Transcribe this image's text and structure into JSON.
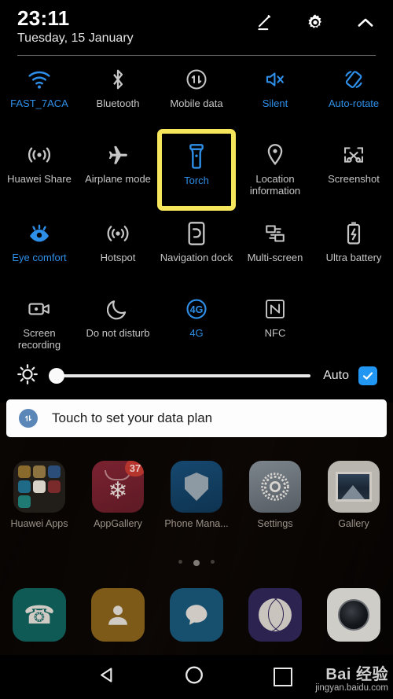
{
  "statusbar": {
    "time": "23:11",
    "date": "Tuesday, 15 January",
    "icons": {
      "edit": "pencil-edit-icon",
      "settings": "gear-icon",
      "collapse": "chevron-up-icon"
    }
  },
  "quick_settings": {
    "rows": [
      [
        {
          "label": "FAST_7ACA",
          "icon": "wifi-icon",
          "active": true
        },
        {
          "label": "Bluetooth",
          "icon": "bluetooth-icon",
          "active": false
        },
        {
          "label": "Mobile data",
          "icon": "mobile-data-icon",
          "active": false
        },
        {
          "label": "Silent",
          "icon": "mute-icon",
          "active": true
        },
        {
          "label": "Auto-rotate",
          "icon": "auto-rotate-icon",
          "active": true
        }
      ],
      [
        {
          "label": "Huawei Share",
          "icon": "huawei-share-icon",
          "active": false
        },
        {
          "label": "Airplane mode",
          "icon": "airplane-icon",
          "active": false
        },
        {
          "label": "Torch",
          "icon": "torch-icon",
          "active": true,
          "highlighted": true
        },
        {
          "label": "Location information",
          "icon": "location-pin-icon",
          "active": false
        },
        {
          "label": "Screenshot",
          "icon": "screenshot-icon",
          "active": false
        }
      ],
      [
        {
          "label": "Eye comfort",
          "icon": "eye-icon",
          "active": true
        },
        {
          "label": "Hotspot",
          "icon": "hotspot-icon",
          "active": false
        },
        {
          "label": "Navigation dock",
          "icon": "navigation-dock-icon",
          "active": false
        },
        {
          "label": "Multi-screen",
          "icon": "multi-screen-icon",
          "active": false
        },
        {
          "label": "Ultra battery",
          "icon": "battery-saver-icon",
          "active": false
        }
      ],
      [
        {
          "label": "Screen recording",
          "icon": "screen-record-icon",
          "active": false
        },
        {
          "label": "Do not disturb",
          "icon": "moon-icon",
          "active": false
        },
        {
          "label": "4G",
          "icon": "network-4g-icon",
          "active": true
        },
        {
          "label": "NFC",
          "icon": "nfc-icon",
          "active": false
        },
        {
          "label": "",
          "icon": "",
          "active": false
        }
      ]
    ],
    "highlight_color": "#f5e65c",
    "accent_color": "#2e8fe8"
  },
  "brightness": {
    "icon": "brightness-sun-icon",
    "value_percent": 2,
    "auto_label": "Auto",
    "auto_checked": true,
    "checkbox_color": "#2196f3"
  },
  "notification": {
    "icon": "mobile-data-icon",
    "text": "Touch to set your data plan"
  },
  "home": {
    "apps": [
      {
        "label": "Huawei Apps",
        "icon": "folder-icon"
      },
      {
        "label": "AppGallery",
        "icon": "appgallery-icon",
        "badge": "37"
      },
      {
        "label": "Phone Mana...",
        "icon": "phone-manager-icon"
      },
      {
        "label": "Settings",
        "icon": "gear-icon"
      },
      {
        "label": "Gallery",
        "icon": "gallery-icon"
      }
    ],
    "page_dots": {
      "count": 3,
      "active_index": 1
    },
    "dock": [
      {
        "name": "phone-app",
        "glyph": "✆"
      },
      {
        "name": "contacts-app",
        "glyph": "●"
      },
      {
        "name": "messages-app",
        "glyph": "●"
      },
      {
        "name": "browser-app",
        "glyph": ""
      },
      {
        "name": "camera-app",
        "glyph": ""
      }
    ]
  },
  "navbar": {
    "back": "back-triangle-icon",
    "home": "home-circle-icon",
    "recents": "recents-square-icon",
    "watermark_main": "Bai  经验",
    "watermark_sub": "jingyan.baidu.com"
  }
}
